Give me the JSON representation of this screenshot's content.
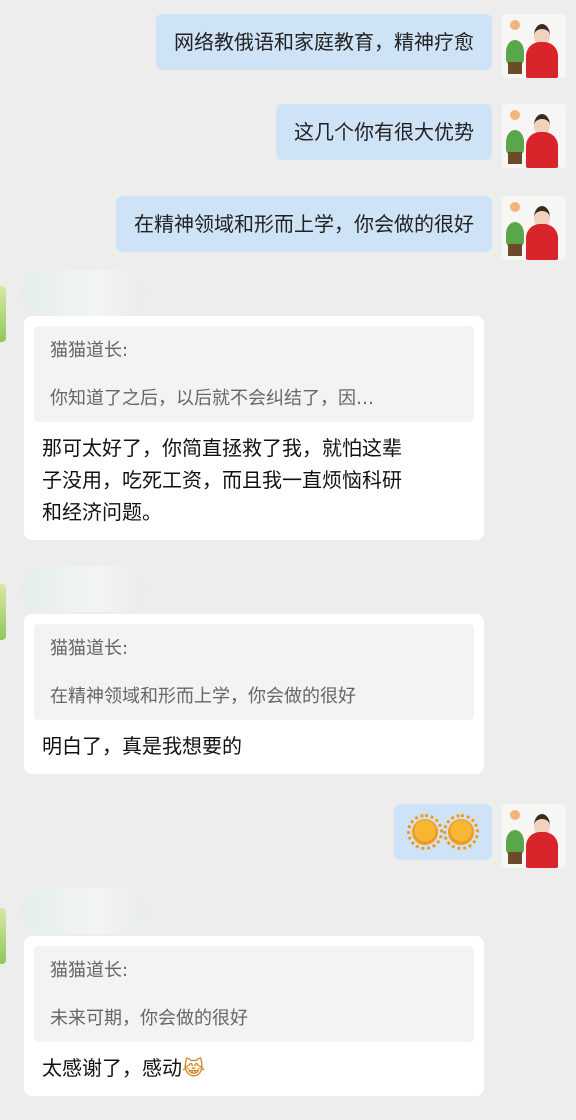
{
  "sent_messages": [
    {
      "text": "网络教俄语和家庭教育，精神疗愈"
    },
    {
      "text": "这几个你有很大优势"
    },
    {
      "text": "在精神领域和形而上学，你会做的很好"
    }
  ],
  "received_messages": [
    {
      "quote_author": "猫猫道长:",
      "quote_text": "你知道了之后，以后就不会纠结了，因…",
      "reply_lines": [
        "那可太好了，你简直拯救了我，就怕这辈",
        "子没用，吃死工资，而且我一直烦恼科研",
        "和经济问题。"
      ]
    },
    {
      "quote_author": "猫猫道长:",
      "quote_text": "在精神领域和形而上学，你会做的很好",
      "reply_lines": [
        "明白了，真是我想要的"
      ]
    },
    {
      "quote_author": "猫猫道长:",
      "quote_text": "未来可期，你会做的很好",
      "reply_lines": [
        "太感谢了，感动"
      ],
      "reply_emoji": "😹"
    }
  ],
  "emoji_message": {
    "icons": [
      "sun-emoji",
      "sun-emoji"
    ]
  },
  "colors": {
    "sent_bubble": "#cfe3f7",
    "background": "#ededed",
    "card": "#ffffff"
  }
}
